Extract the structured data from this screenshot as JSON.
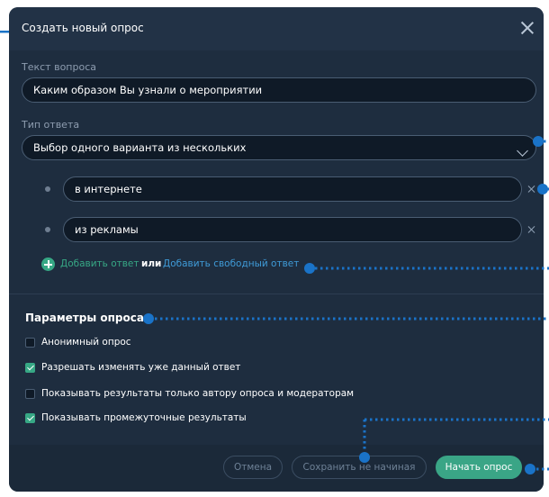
{
  "modal": {
    "title": "Создать новый опрос"
  },
  "question": {
    "label": "Текст вопроса",
    "value": "Каким образом Вы узнали о мероприятии"
  },
  "answer_type": {
    "label": "Тип ответа",
    "selected": "Выбор одного варианта из нескольких"
  },
  "answers": [
    {
      "value": "в интернете"
    },
    {
      "value": "из рекламы"
    }
  ],
  "add_links": {
    "add_answer": "Добавить ответ",
    "or": "или",
    "add_free_answer": "Добавить свободный ответ"
  },
  "settings": {
    "title": "Параметры опроса",
    "options": [
      {
        "label": "Анонимный опрос",
        "checked": false
      },
      {
        "label": "Разрешать изменять уже данный ответ",
        "checked": true
      },
      {
        "label": "Показывать результаты только автору опроса и модераторам",
        "checked": false
      },
      {
        "label": "Показывать промежуточные результаты",
        "checked": true
      }
    ]
  },
  "footer": {
    "cancel": "Отмена",
    "save_draft": "Сохранить не начиная",
    "start": "Начать опрос"
  },
  "colors": {
    "background": "#1e2d3f",
    "accent_green": "#37a885",
    "link_blue": "#3f9bd8",
    "annotation_blue": "#1a73c8"
  }
}
